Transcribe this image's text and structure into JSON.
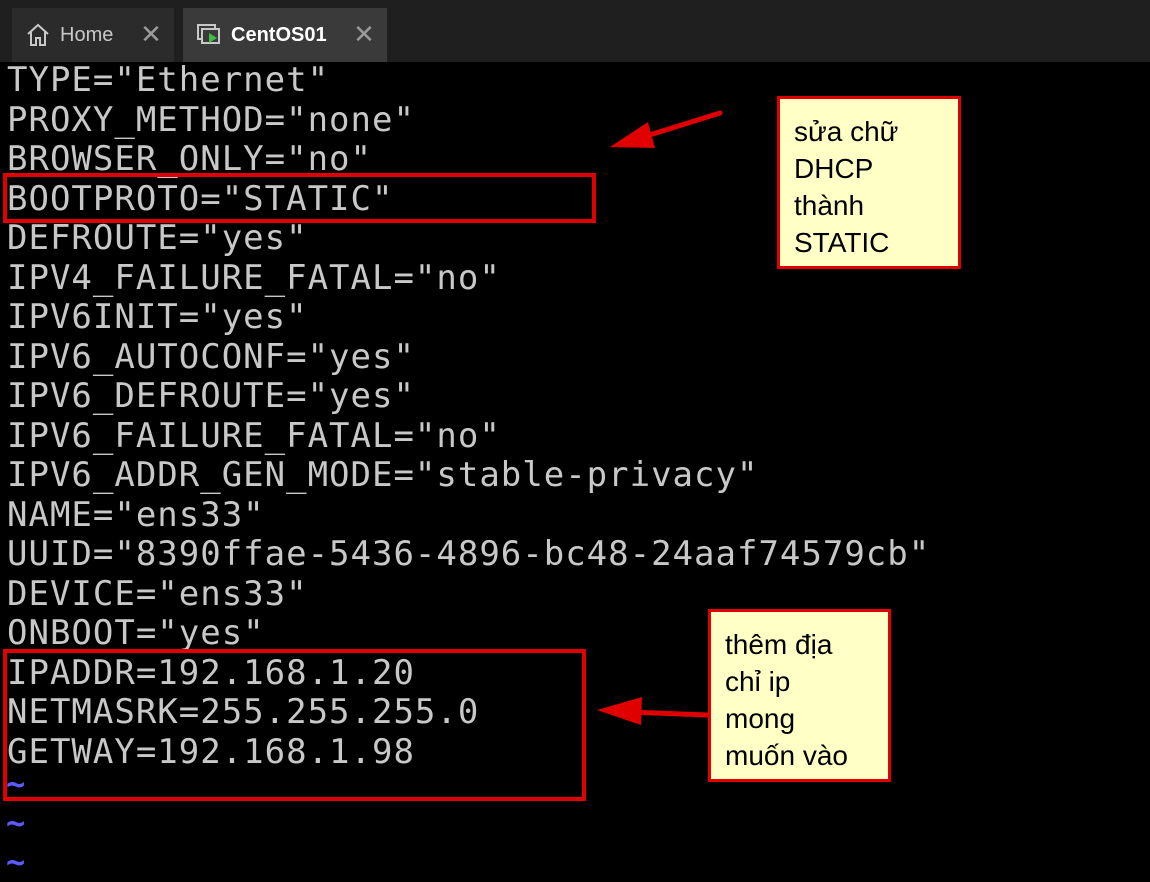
{
  "tabs": [
    {
      "label": "Home",
      "icon": "home-icon",
      "active": false
    },
    {
      "label": "CentOS01",
      "icon": "vm-console-icon",
      "active": true
    }
  ],
  "terminal": {
    "lines": [
      "TYPE=\"Ethernet\"",
      "PROXY_METHOD=\"none\"",
      "BROWSER_ONLY=\"no\"",
      "BOOTPROTO=\"STATIC\"",
      "DEFROUTE=\"yes\"",
      "IPV4_FAILURE_FATAL=\"no\"",
      "IPV6INIT=\"yes\"",
      "IPV6_AUTOCONF=\"yes\"",
      "IPV6_DEFROUTE=\"yes\"",
      "IPV6_FAILURE_FATAL=\"no\"",
      "IPV6_ADDR_GEN_MODE=\"stable-privacy\"",
      "NAME=\"ens33\"",
      "UUID=\"8390ffae-5436-4896-bc48-24aaf74579cb\"",
      "DEVICE=\"ens33\"",
      "ONBOOT=\"yes\"",
      "IPADDR=192.168.1.20",
      "NETMASRK=255.255.255.0",
      "GETWAY=192.168.1.98"
    ],
    "tildes": [
      "~",
      "~",
      "~"
    ],
    "text_color": "#c8c8c8",
    "tilde_color": "#5b5bff"
  },
  "annotations": {
    "note_static": [
      "sửa chữ",
      "DHCP",
      "thành",
      "STATIC"
    ],
    "note_ip": [
      "thêm địa",
      "chỉ ip",
      "mong",
      "muốn vào"
    ],
    "highlight_color": "#e00000",
    "note_background": "#ffffc6"
  }
}
